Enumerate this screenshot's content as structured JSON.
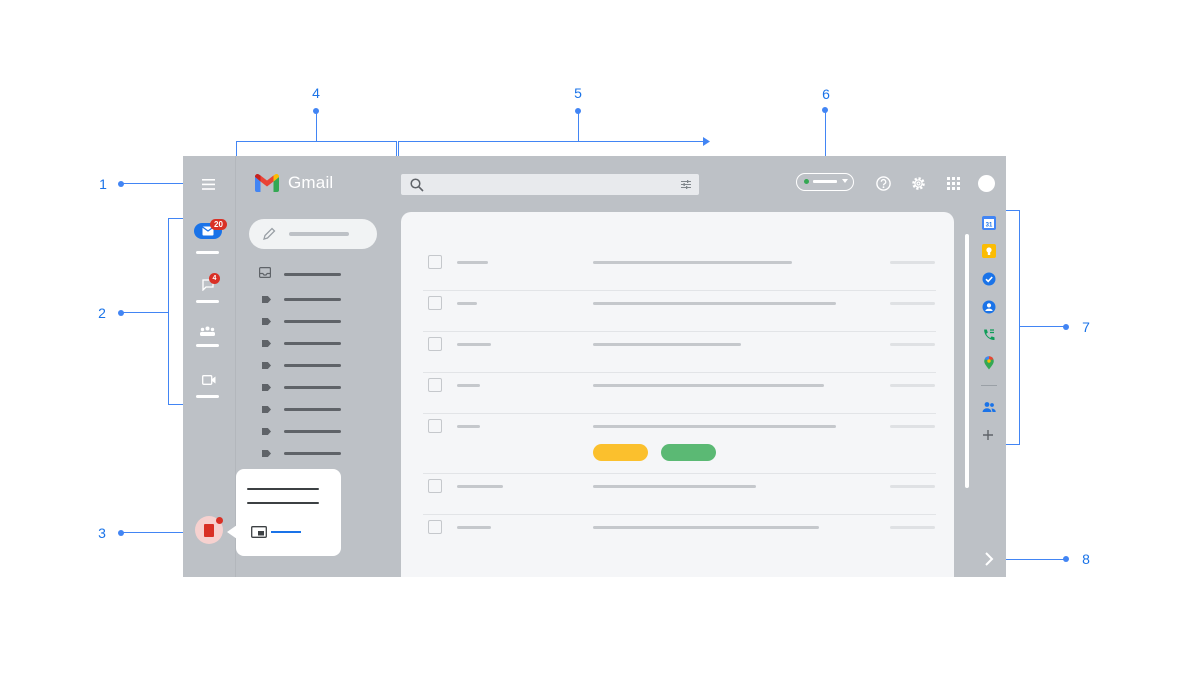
{
  "callouts": {
    "one": "1",
    "two": "2",
    "three": "3",
    "four": "4",
    "five": "5",
    "six": "6",
    "seven": "7",
    "eight": "8"
  },
  "app": {
    "name": "Gmail",
    "mail_badge": "20",
    "chat_badge": "4",
    "calendar_day": "31"
  },
  "colors": {
    "annotation": "#1a73e8",
    "window_gray": "#bdc1c6",
    "badge_red": "#d93025",
    "chip_yellow": "#fbc02d",
    "chip_green": "#5bb974",
    "blue": "#1a73e8"
  },
  "icons": [
    "menu-icon",
    "gmail-logo-icon",
    "search-icon",
    "tune-icon",
    "help-icon",
    "settings-icon",
    "apps-grid-icon",
    "avatar",
    "mail-icon",
    "chat-icon",
    "spaces-icon",
    "meet-icon",
    "pencil-icon",
    "inbox-icon",
    "label-icon",
    "calendar-icon",
    "keep-icon",
    "tasks-icon",
    "contacts-icon",
    "voice-icon",
    "maps-icon",
    "people-icon",
    "plus-icon",
    "chevron-right-icon",
    "picture-in-picture-icon"
  ],
  "email_rows": [
    {
      "sender_fill": 0.29,
      "subject_fill": 0.82,
      "has_chips": false
    },
    {
      "sender_fill": 0.19,
      "subject_fill": 1.0,
      "has_chips": false
    },
    {
      "sender_fill": 0.32,
      "subject_fill": 0.61,
      "has_chips": false
    },
    {
      "sender_fill": 0.22,
      "subject_fill": 0.95,
      "has_chips": false
    },
    {
      "sender_fill": 0.22,
      "subject_fill": 1.0,
      "has_chips": true
    },
    {
      "sender_fill": 0.43,
      "subject_fill": 0.67,
      "has_chips": false
    },
    {
      "sender_fill": 0.32,
      "subject_fill": 0.93,
      "has_chips": false
    }
  ]
}
